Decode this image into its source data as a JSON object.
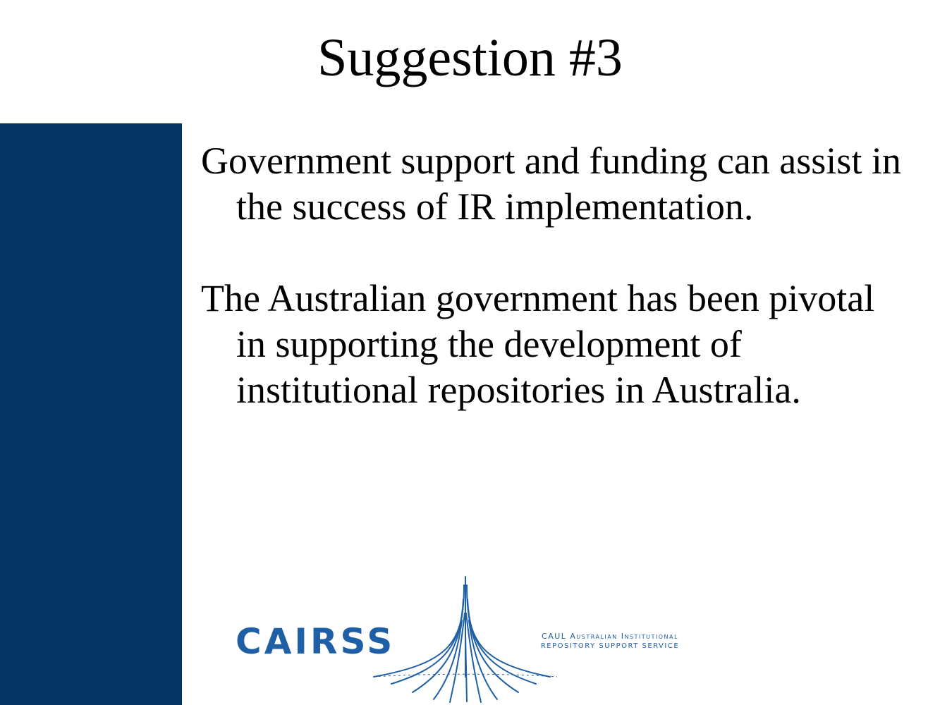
{
  "slide": {
    "title": "Suggestion #3",
    "paragraphs": [
      "Government support and funding can assist in the success of IR implementation.",
      "The Australian government has been pivotal in supporting the development of institutional repositories in Australia."
    ]
  },
  "logo": {
    "wordmark": "CAIRSS",
    "tagline_line1": "CAUL Australian Institutional",
    "tagline_line2": "repository support service",
    "color": "#1f5fa6"
  },
  "colors": {
    "sidebar": "#033565",
    "text": "#000000",
    "background": "#ffffff"
  }
}
